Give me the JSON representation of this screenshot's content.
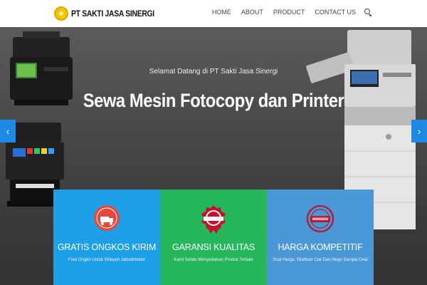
{
  "header": {
    "logo_text": "PT SAKTI JASA SINERGI",
    "nav": [
      "HOME",
      "ABOUT",
      "PRODUCT",
      "CONTACT US"
    ]
  },
  "hero": {
    "subtitle": "Selamat Datang di PT Sakti Jasa Sinergi",
    "title": "Sewa Mesin Fotocopy dan Printer",
    "prev_label": "‹",
    "next_label": "›"
  },
  "features": [
    {
      "title": "GRATIS ONGKOS KIRIM",
      "desc": "Free Ongkir Untuk Wilayah Jabodetabek",
      "color": "#1ea0e8",
      "icon": "free-shipping-badge-icon"
    },
    {
      "title": "GARANSI KUALITAS",
      "desc": "Kami Selalu Menyediakan Produk Terbaik",
      "color": "#26b65c",
      "icon": "best-quality-badge-icon"
    },
    {
      "title": "HARGA KOMPETITIF",
      "desc": "Soal Harga, Silahkan Cek Dan Nego Sampai Deal",
      "color": "#4a98d8",
      "icon": "best-price-stamp-icon"
    }
  ],
  "colors": {
    "accent": "#1e88e5",
    "header_bg": "#ffffff",
    "hero_bg": "#4b4b4b"
  }
}
